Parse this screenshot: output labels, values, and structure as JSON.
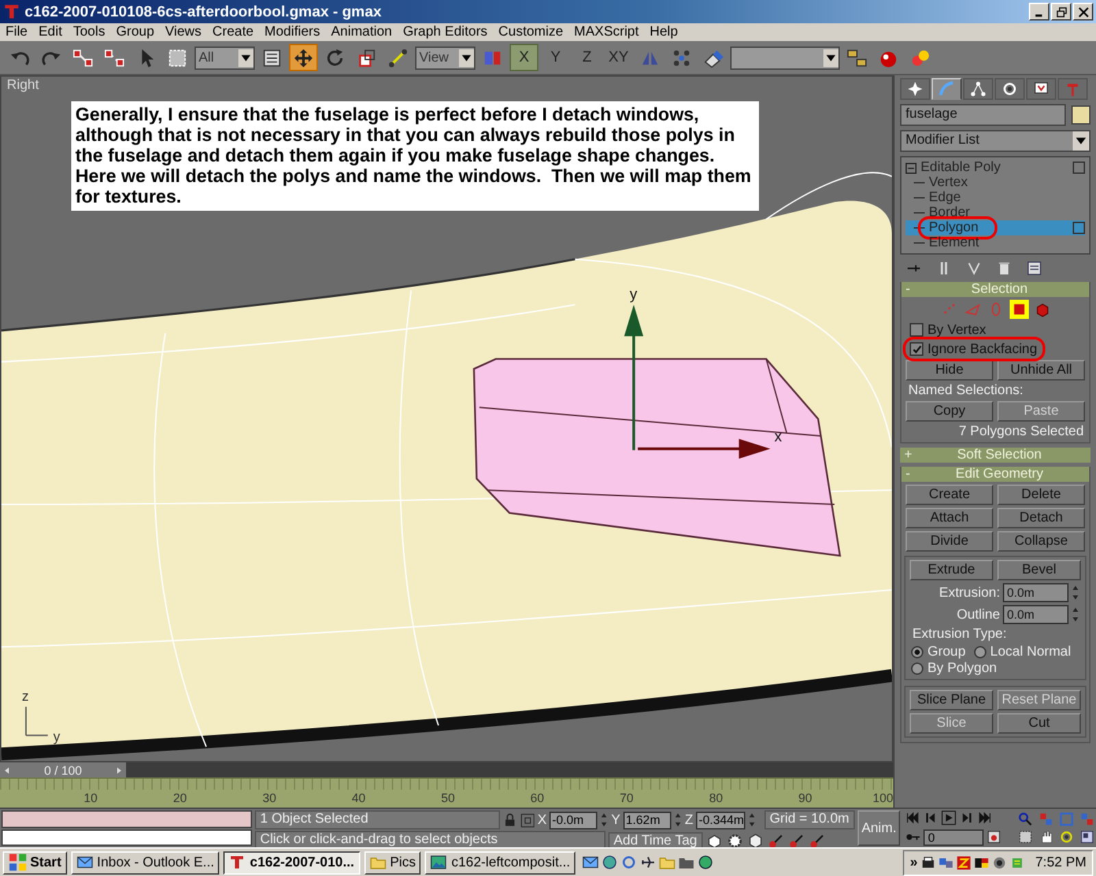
{
  "window": {
    "title": "c162-2007-010108-6cs-afterdoorbool.gmax - gmax"
  },
  "menu": [
    "File",
    "Edit",
    "Tools",
    "Group",
    "Views",
    "Create",
    "Modifiers",
    "Animation",
    "Graph Editors",
    "Customize",
    "MAXScript",
    "Help"
  ],
  "toolbar": [
    {
      "kind": "undo",
      "selected": false
    },
    {
      "kind": "redo",
      "selected": false
    },
    {
      "kind": "link",
      "selected": false
    },
    {
      "kind": "unlink",
      "selected": false
    },
    {
      "kind": "select",
      "selected": false
    },
    {
      "kind": "region",
      "selected": false
    },
    {
      "kind": "dropdown",
      "value": "All"
    },
    {
      "kind": "byname",
      "selected": false
    },
    {
      "kind": "move",
      "selected": true
    },
    {
      "kind": "rotate",
      "selected": false
    },
    {
      "kind": "scale",
      "selected": false
    },
    {
      "kind": "manipulate",
      "selected": false
    },
    {
      "kind": "dropdown",
      "value": "View"
    },
    {
      "kind": "pivot",
      "selected": false
    },
    {
      "kind": "axis",
      "label": "X",
      "selected": true
    },
    {
      "kind": "axis",
      "label": "Y",
      "selected": false
    },
    {
      "kind": "axis",
      "label": "Z",
      "selected": false
    },
    {
      "kind": "axis",
      "label": "XY",
      "selected": false
    },
    {
      "kind": "mirror",
      "selected": false
    },
    {
      "kind": "array",
      "selected": false
    },
    {
      "kind": "snap",
      "selected": false
    },
    {
      "kind": "dropdown"
    },
    {
      "kind": "layers",
      "selected": false
    },
    {
      "kind": "render",
      "selected": false
    },
    {
      "kind": "material",
      "selected": false
    }
  ],
  "viewport": {
    "label": "Right",
    "note": "Generally, I ensure that the fuselage is perfect before I detach windows, although that is not necessary in that you can always rebuild those polys in the fuselage and detach them again if you make fuselage shape changes.  Here we will detach the polys and name the windows.  Then we will map them for textures.",
    "gizmo_labels": [
      "y",
      "x"
    ],
    "tripod_labels": [
      "z",
      "y"
    ]
  },
  "command_panel": {
    "tabs": [
      {
        "kind": "create",
        "selected": false
      },
      {
        "kind": "modify",
        "selected": true
      },
      {
        "kind": "hierarchy",
        "selected": false
      },
      {
        "kind": "motion",
        "selected": false
      },
      {
        "kind": "display",
        "selected": false
      },
      {
        "kind": "utilities",
        "selected": false
      }
    ],
    "object_name": "fuselage",
    "modifier_list": "Modifier List",
    "stack": [
      {
        "label": "Editable Poly",
        "expanded": true,
        "children": [
          {
            "label": "Vertex",
            "selected": false,
            "circled": false
          },
          {
            "label": "Edge",
            "selected": false,
            "circled": false
          },
          {
            "label": "Border",
            "selected": false,
            "circled": false
          },
          {
            "label": "Polygon",
            "selected": true,
            "circled": true
          },
          {
            "label": "Element",
            "selected": false,
            "circled": false
          }
        ]
      }
    ],
    "selection": {
      "sign": "-",
      "title": "Selection",
      "modes": [
        {
          "kind": "vertex",
          "selected": false
        },
        {
          "kind": "edge",
          "selected": false
        },
        {
          "kind": "border",
          "selected": false
        },
        {
          "kind": "polygon",
          "selected": true
        },
        {
          "kind": "element",
          "selected": false
        }
      ],
      "checkboxes": [
        {
          "label": "By Vertex",
          "checked": false,
          "circled": false
        },
        {
          "label": "Ignore Backfacing",
          "checked": true,
          "circled": true
        }
      ],
      "buttons": [
        {
          "label": "Hide",
          "disabled": false
        },
        {
          "label": "Unhide All",
          "disabled": false
        }
      ],
      "named_label": "Named Selections:",
      "named_buttons": [
        {
          "label": "Copy",
          "disabled": false
        },
        {
          "label": "Paste",
          "disabled": true
        }
      ],
      "status": "7 Polygons Selected"
    },
    "soft_selection": {
      "sign": "+",
      "title": "Soft Selection"
    },
    "edit_geometry": {
      "sign": "-",
      "title": "Edit Geometry",
      "buttons": [
        {
          "label": "Create",
          "disabled": false
        },
        {
          "label": "Delete",
          "disabled": false
        },
        {
          "label": "Attach",
          "disabled": false
        },
        {
          "label": "Detach",
          "disabled": false
        },
        {
          "label": "Divide",
          "disabled": false
        },
        {
          "label": "Collapse",
          "disabled": false
        }
      ],
      "extrude_buttons": [
        {
          "label": "Extrude",
          "disabled": false
        },
        {
          "label": "Bevel",
          "disabled": false
        }
      ],
      "spinners": [
        {
          "label": "Extrusion:",
          "value": "0.0m"
        },
        {
          "label": "Outline",
          "value": "0.0m"
        }
      ],
      "type_label": "Extrusion Type:",
      "radios": [
        {
          "label": "Group",
          "selected": true
        },
        {
          "label": "Local Normal",
          "selected": false
        },
        {
          "label": "By Polygon",
          "selected": false
        }
      ],
      "slice_buttons": [
        {
          "label": "Slice Plane",
          "disabled": false
        },
        {
          "label": "Reset Plane",
          "disabled": true
        },
        {
          "label": "Slice",
          "disabled": true
        },
        {
          "label": "Cut",
          "disabled": false
        }
      ]
    }
  },
  "timeline": {
    "slider": "0 / 100",
    "level": 0,
    "ticks": [
      "10",
      "20",
      "30",
      "40",
      "50",
      "60",
      "70",
      "80",
      "90",
      "100"
    ]
  },
  "status": {
    "selection": "1 Object Selected",
    "prompt": "Click or click-and-drag to select objects",
    "coords": [
      {
        "axis": "X",
        "value": "-0.0m"
      },
      {
        "axis": "Y",
        "value": "1.62m"
      },
      {
        "axis": "Z",
        "value": "-0.344m"
      }
    ],
    "grid": "Grid = 10.0m",
    "time_tag": "Add Time Tag",
    "anim": "Anim.",
    "frame": "0"
  },
  "taskbar": {
    "start": "Start",
    "tasks": [
      {
        "kind": "mail",
        "label": "Inbox - Outlook E...",
        "selected": false
      },
      {
        "kind": "gmax",
        "label": "c162-2007-010...",
        "selected": true
      },
      {
        "kind": "folder",
        "label": "Pics",
        "selected": false
      },
      {
        "kind": "image",
        "label": "c162-leftcomposit...",
        "selected": false
      }
    ],
    "chevron": "»",
    "clock": "7:52 PM"
  }
}
